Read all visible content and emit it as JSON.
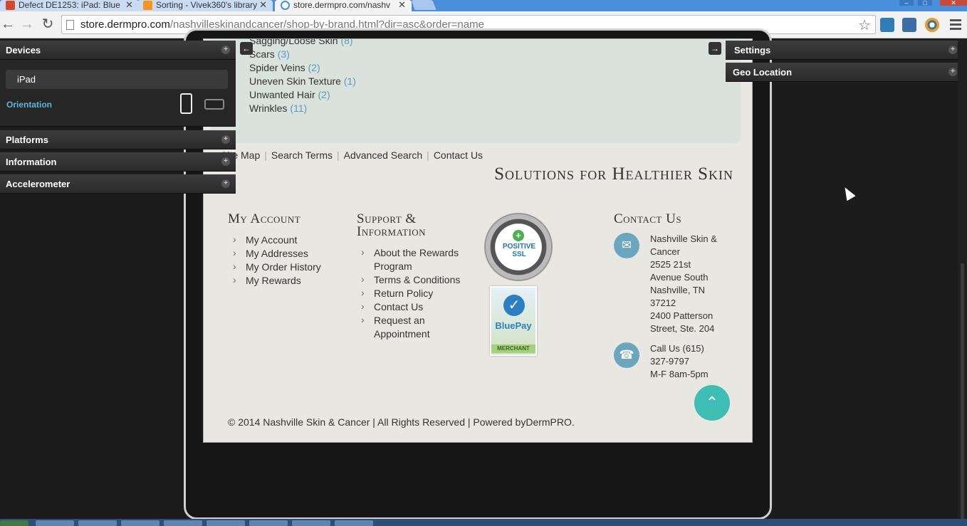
{
  "browser": {
    "tabs": [
      {
        "title": "Defect DE1253: iPad: Blue",
        "icon": "rally-icon",
        "active": false
      },
      {
        "title": "Sorting - Vivek360's library",
        "icon": "rss-icon",
        "active": false
      },
      {
        "title": "store.dermpro.com/nashv",
        "icon": "loading-icon",
        "active": true
      }
    ],
    "url_host": "store.dermpro.com",
    "url_rest": "/nashvilleskinandcancer/shop-by-brand.html?dir=asc&order=name"
  },
  "emulator": {
    "left_panels": {
      "devices": "Devices",
      "platforms": "Platforms",
      "information": "Information",
      "accelerometer": "Accelerometer"
    },
    "device_name": "iPad",
    "orientation_label": "Orientation",
    "right_panels": {
      "settings": "Settings",
      "geo_location": "Geo Location"
    }
  },
  "site": {
    "categories": [
      {
        "name": "Sagging/Loose Skin",
        "count": "(8)"
      },
      {
        "name": "Scars",
        "count": "(3)"
      },
      {
        "name": "Spider Veins",
        "count": "(2)"
      },
      {
        "name": "Uneven Skin Texture",
        "count": "(1)"
      },
      {
        "name": "Unwanted Hair",
        "count": "(2)"
      },
      {
        "name": "Wrinkles",
        "count": "(11)"
      }
    ],
    "footer_links": [
      "Site Map",
      "Search Terms",
      "Advanced Search",
      "Contact Us"
    ],
    "slogan": "Solutions for Healthier Skin",
    "my_account": {
      "title": "My Account",
      "links": [
        "My Account",
        "My Addresses",
        "My Order History",
        "My Rewards"
      ]
    },
    "support": {
      "title_line1": "Support &",
      "title_line2": "Information",
      "links": [
        "About the Rewards Program",
        "Terms & Conditions",
        "Return Policy",
        "Contact Us",
        "Request an Appointment"
      ]
    },
    "badges": {
      "ssl": "POSITIVE SSL",
      "bluepay": "BluePay",
      "bluepay_tag": "MERCHANT"
    },
    "contact": {
      "title": "Contact Us",
      "address": "Nashville Skin &\nCancer\n2525 21st\nAvenue South\nNashville, TN\n37212\n2400 Patterson\nStreet, Ste. 204",
      "phone": "Call Us (615)\n327-9797\nM-F 8am-5pm"
    },
    "copyright": "© 2014 Nashville Skin & Cancer | All Rights Reserved | Powered byDermPRO."
  }
}
